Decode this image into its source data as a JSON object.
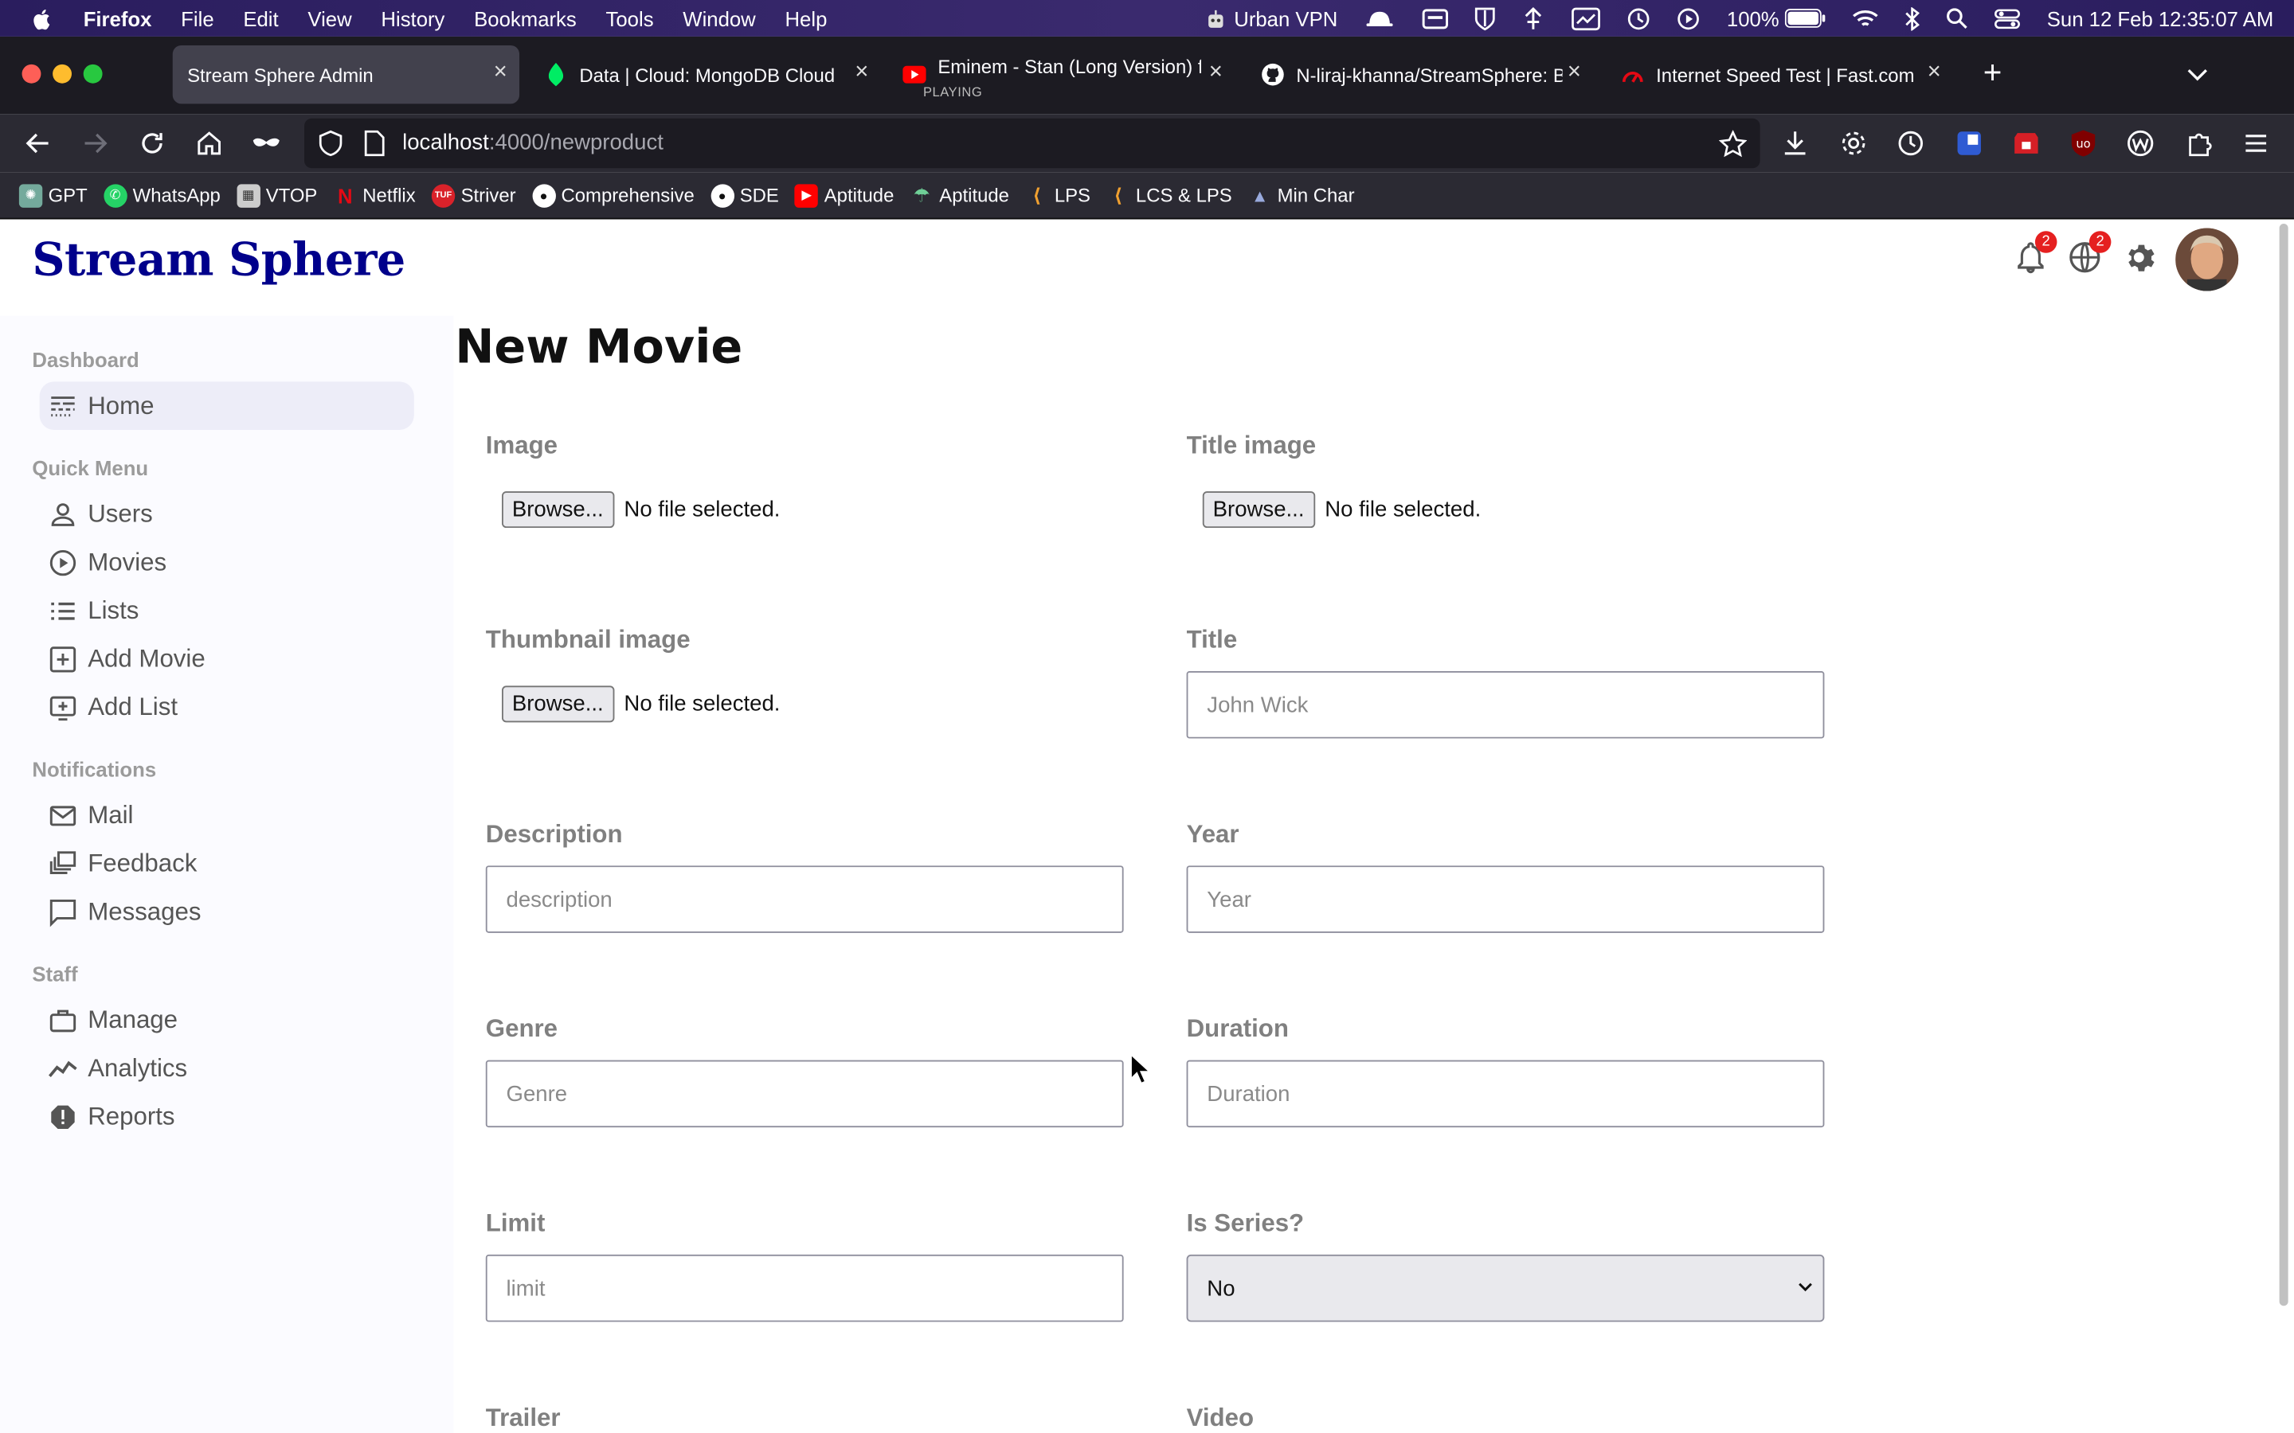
{
  "menubar": {
    "app_name": "Firefox",
    "items": [
      "File",
      "Edit",
      "View",
      "History",
      "Bookmarks",
      "Tools",
      "Window",
      "Help"
    ],
    "vpn_label": "Urban VPN",
    "battery": "100%",
    "clock": "Sun 12 Feb  12:35:07 AM"
  },
  "tabs": [
    {
      "title": "Stream Sphere Admin",
      "active": true
    },
    {
      "title": "Data | Cloud: MongoDB Cloud",
      "active": false
    },
    {
      "title": "Eminem - Stan (Long Version) ft",
      "subtitle": "PLAYING",
      "active": false
    },
    {
      "title": "N-liraj-khanna/StreamSphere: B",
      "active": false
    },
    {
      "title": "Internet Speed Test | Fast.com",
      "active": false
    }
  ],
  "url": {
    "host": "localhost",
    "path": ":4000/newproduct"
  },
  "bookmarks": [
    "GPT",
    "WhatsApp",
    "VTOP",
    "Netflix",
    "Striver",
    "Comprehensive",
    "SDE",
    "Aptitude",
    "Aptitude",
    "LPS",
    "LCS & LPS",
    "Min Char"
  ],
  "app": {
    "logo": "Stream Sphere",
    "notif_badge": "2",
    "lang_badge": "2"
  },
  "sidebar": {
    "sections": [
      {
        "title": "Dashboard",
        "items": [
          {
            "label": "Home",
            "icon": "line-style-icon",
            "active": true
          }
        ]
      },
      {
        "title": "Quick Menu",
        "items": [
          {
            "label": "Users",
            "icon": "person-icon"
          },
          {
            "label": "Movies",
            "icon": "play-circle-icon"
          },
          {
            "label": "Lists",
            "icon": "list-icon"
          },
          {
            "label": "Add Movie",
            "icon": "add-box-icon"
          },
          {
            "label": "Add List",
            "icon": "add-to-queue-icon"
          }
        ]
      },
      {
        "title": "Notifications",
        "items": [
          {
            "label": "Mail",
            "icon": "mail-icon"
          },
          {
            "label": "Feedback",
            "icon": "dynamic-feed-icon"
          },
          {
            "label": "Messages",
            "icon": "chat-bubble-icon"
          }
        ]
      },
      {
        "title": "Staff",
        "items": [
          {
            "label": "Manage",
            "icon": "work-icon"
          },
          {
            "label": "Analytics",
            "icon": "timeline-icon"
          },
          {
            "label": "Reports",
            "icon": "report-icon"
          }
        ]
      }
    ]
  },
  "form": {
    "title": "New Movie",
    "browse_label": "Browse...",
    "no_file": "No file selected.",
    "image_label": "Image",
    "title_image_label": "Title image",
    "thumbnail_label": "Thumbnail image",
    "title_label": "Title",
    "title_placeholder": "John Wick",
    "description_label": "Description",
    "description_placeholder": "description",
    "year_label": "Year",
    "year_placeholder": "Year",
    "genre_label": "Genre",
    "genre_placeholder": "Genre",
    "duration_label": "Duration",
    "duration_placeholder": "Duration",
    "limit_label": "Limit",
    "limit_placeholder": "limit",
    "is_series_label": "Is Series?",
    "is_series_value": "No",
    "trailer_label": "Trailer",
    "video_label": "Video"
  }
}
